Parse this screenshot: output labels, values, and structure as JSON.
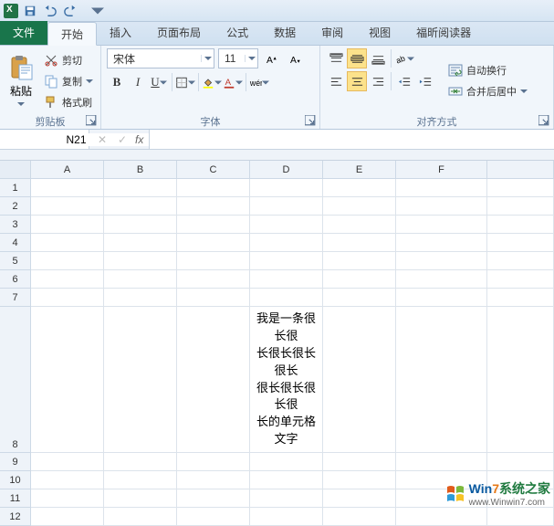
{
  "qat": {
    "save_name": "save-icon",
    "undo_name": "undo-icon",
    "redo_name": "redo-icon"
  },
  "tabs": {
    "file": "文件",
    "items": [
      "开始",
      "插入",
      "页面布局",
      "公式",
      "数据",
      "审阅",
      "视图",
      "福昕阅读器"
    ],
    "active_index": 0
  },
  "ribbon": {
    "clipboard": {
      "label": "剪贴板",
      "paste": "粘贴",
      "cut": "剪切",
      "copy": "复制",
      "format_painter": "格式刷"
    },
    "font": {
      "label": "字体",
      "name": "宋体",
      "size": "11",
      "bold": "B",
      "italic": "I",
      "underline": "U"
    },
    "align": {
      "label": "对齐方式",
      "wrap": "自动换行",
      "merge": "合并后居中"
    }
  },
  "formula_bar": {
    "name_box": "N21",
    "fx": "fx",
    "value": ""
  },
  "grid": {
    "cols": [
      "A",
      "B",
      "C",
      "D",
      "E",
      "F"
    ],
    "rows": [
      "1",
      "2",
      "3",
      "4",
      "5",
      "6",
      "7",
      "8",
      "9",
      "10",
      "11",
      "12"
    ],
    "d8": "我是一条很\n长很\n长很长很长\n很长\n很长很长很\n长很\n长的单元格\n文字"
  },
  "watermark": {
    "brand1a": "Win",
    "brand1b": "7",
    "brand2": "系统之家",
    "url": "www.Winwin7.com"
  }
}
